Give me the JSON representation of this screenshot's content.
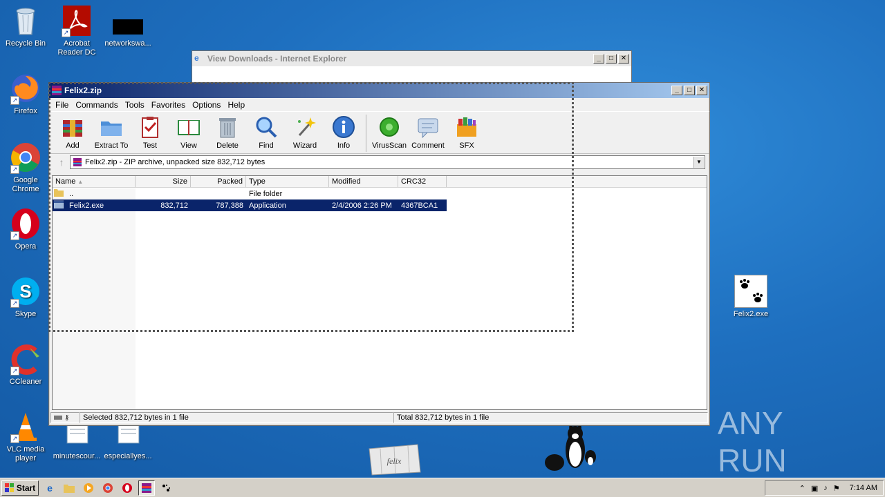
{
  "desktop": {
    "icons": [
      {
        "label": "Recycle Bin"
      },
      {
        "label": "Acrobat Reader DC"
      },
      {
        "label": "networkswa..."
      },
      {
        "label": "Firefox"
      },
      {
        "label": "Google Chrome"
      },
      {
        "label": "Opera"
      },
      {
        "label": "Skype"
      },
      {
        "label": "CCleaner"
      },
      {
        "label": "VLC media player"
      },
      {
        "label": "minutescour..."
      },
      {
        "label": "especiallyes..."
      },
      {
        "label": "Felix2.exe"
      }
    ],
    "watermark": "ANY RUN",
    "box_text": "felix"
  },
  "ie_window": {
    "title": "View Downloads - Internet Explorer"
  },
  "winrar": {
    "title": "Felix2.zip",
    "menu": [
      "File",
      "Commands",
      "Tools",
      "Favorites",
      "Options",
      "Help"
    ],
    "toolbar": [
      {
        "label": "Add",
        "icon": "add-archive-icon"
      },
      {
        "label": "Extract To",
        "icon": "extract-folder-icon"
      },
      {
        "label": "Test",
        "icon": "test-clipboard-icon"
      },
      {
        "label": "View",
        "icon": "view-book-icon"
      },
      {
        "label": "Delete",
        "icon": "trash-icon"
      },
      {
        "label": "Find",
        "icon": "magnifier-icon"
      },
      {
        "label": "Wizard",
        "icon": "wand-icon"
      },
      {
        "label": "Info",
        "icon": "info-icon"
      },
      {
        "label": "VirusScan",
        "icon": "virus-icon"
      },
      {
        "label": "Comment",
        "icon": "comment-icon"
      },
      {
        "label": "SFX",
        "icon": "sfx-icon"
      }
    ],
    "address": "Felix2.zip - ZIP archive, unpacked size 832,712 bytes",
    "columns": [
      "Name",
      "Size",
      "Packed",
      "Type",
      "Modified",
      "CRC32"
    ],
    "rows": [
      {
        "name": "..",
        "size": "",
        "packed": "",
        "type": "File folder",
        "modified": "",
        "crc": ""
      },
      {
        "name": "Felix2.exe",
        "size": "832,712",
        "packed": "787,388",
        "type": "Application",
        "modified": "2/4/2006 2:26 PM",
        "crc": "4367BCA1"
      }
    ],
    "status_left": "Selected 832,712 bytes in 1 file",
    "status_right": "Total 832,712 bytes in 1 file"
  },
  "taskbar": {
    "start_label": "Start",
    "clock": "7:14 AM"
  },
  "colors": {
    "selection": "#0a246a",
    "desktop": "#1e6fbf",
    "title_active": "#0a246a"
  }
}
